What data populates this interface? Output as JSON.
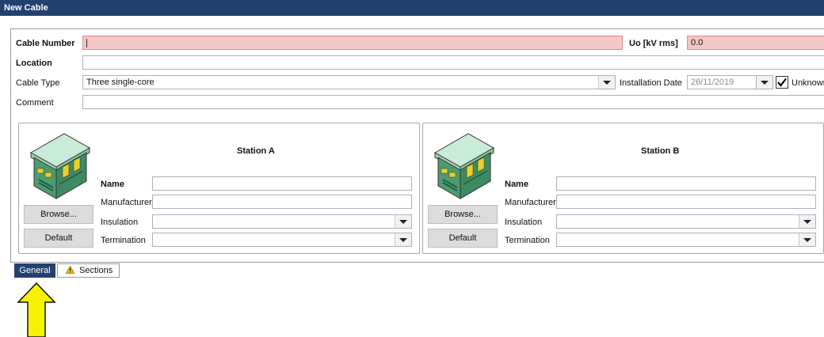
{
  "window": {
    "title": "New Cable"
  },
  "form": {
    "cable_number": {
      "label": "Cable Number",
      "value": ""
    },
    "uo": {
      "label": "Uo [kV rms]",
      "value": "0.0"
    },
    "location": {
      "label": "Location",
      "value": ""
    },
    "cable_type": {
      "label": "Cable Type",
      "value": "Three single-core"
    },
    "installation_date": {
      "label": "Installation Date",
      "value": "26/11/2019"
    },
    "unknown": {
      "label": "Unknown",
      "checked": true
    },
    "comment": {
      "label": "Comment",
      "value": ""
    }
  },
  "stations": [
    {
      "title": "Station A",
      "name_label": "Name",
      "manufacturer_label": "Manufacturer",
      "insulation_label": "Insulation",
      "termination_label": "Termination",
      "browse_label": "Browse...",
      "default_label": "Default"
    },
    {
      "title": "Station B",
      "name_label": "Name",
      "manufacturer_label": "Manufacturer",
      "insulation_label": "Insulation",
      "termination_label": "Termination",
      "browse_label": "Browse...",
      "default_label": "Default"
    }
  ],
  "tabs": [
    {
      "label": "General",
      "active": true
    },
    {
      "label": "Sections",
      "active": false,
      "icon": "warning-icon"
    }
  ],
  "colors": {
    "titlebar": "#23406f",
    "error_field": "#f5c6c6",
    "pointer_arrow": "#f7f200"
  }
}
